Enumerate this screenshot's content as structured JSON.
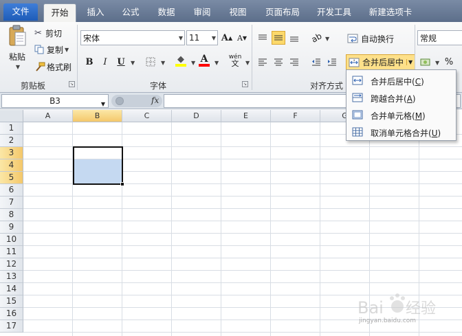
{
  "tabs": [
    {
      "label": "文件"
    },
    {
      "label": "开始"
    },
    {
      "label": "插入"
    },
    {
      "label": "公式"
    },
    {
      "label": "数据"
    },
    {
      "label": "审阅"
    },
    {
      "label": "视图"
    },
    {
      "label": "页面布局"
    },
    {
      "label": "开发工具"
    },
    {
      "label": "新建选项卡"
    }
  ],
  "clipboard": {
    "paste_label": "粘贴",
    "cut_label": "剪切",
    "copy_label": "复制",
    "format_painter_label": "格式刷",
    "group_label": "剪贴板"
  },
  "font": {
    "font_name": "宋体",
    "font_size": "11",
    "group_label": "字体",
    "grow_label": "A",
    "shrink_label": "A",
    "bold_label": "B",
    "italic_label": "I",
    "underline_label": "U",
    "phonetic_label": "wén",
    "highlight_color": "#ffff00",
    "font_color": "#ff0000"
  },
  "alignment": {
    "wrap_text_label": "自动换行",
    "merge_center_label": "合并后居中",
    "group_label": "对齐方式"
  },
  "number": {
    "format_value": "常规",
    "percent_label": "%"
  },
  "formula_bar": {
    "name_box": "B3",
    "fx_label": "fx",
    "formula": ""
  },
  "columns": [
    "A",
    "B",
    "C",
    "D",
    "E",
    "F",
    "G"
  ],
  "rows": [
    "1",
    "2",
    "3",
    "4",
    "5",
    "6",
    "7",
    "8",
    "9",
    "10",
    "11",
    "12",
    "13",
    "14",
    "15",
    "16",
    "17"
  ],
  "selection": {
    "active_cell": "B3",
    "range": "B3:B5",
    "highlight_color": "#c5d9f1"
  },
  "merge_menu": {
    "items": [
      {
        "label": "合并后居中(",
        "key": "C",
        "suffix": ")"
      },
      {
        "label": "跨越合并(",
        "key": "A",
        "suffix": ")"
      },
      {
        "label": "合并单元格(",
        "key": "M",
        "suffix": ")"
      },
      {
        "label": "取消单元格合并(",
        "key": "U",
        "suffix": ")"
      }
    ]
  },
  "colors": {
    "tabbar": "#6b7d98",
    "file_tab": "#2a6ac8",
    "selected_header": "#f4c86b"
  }
}
